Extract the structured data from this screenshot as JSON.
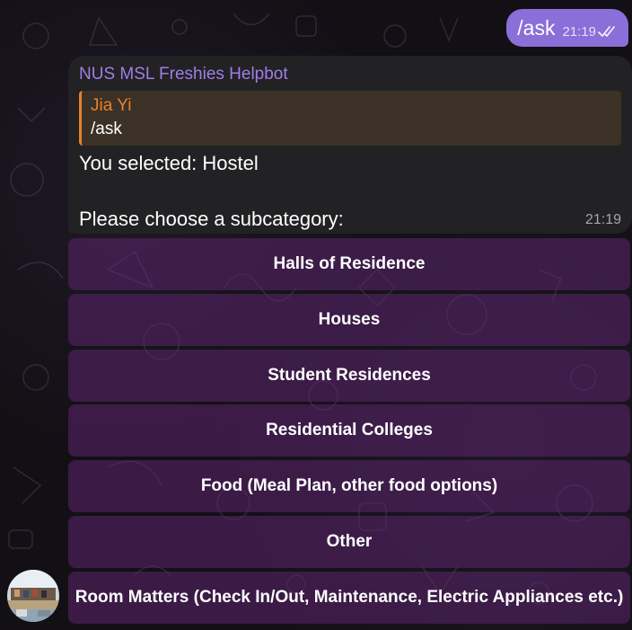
{
  "outgoing": {
    "text": "/ask",
    "time": "21:19",
    "status_icon": "double-check-icon"
  },
  "incoming": {
    "sender": "NUS MSL Freshies Helpbot",
    "reply_to": {
      "name": "Jia Yi",
      "text": "/ask"
    },
    "line1": "You selected: Hostel",
    "line2": "Please choose a subcategory:",
    "time": "21:19"
  },
  "keyboard": {
    "buttons": [
      "Halls of Residence",
      "Houses",
      "Student Residences",
      "Residential Colleges",
      "Food (Meal Plan, other food options)",
      "Other",
      "Room Matters (Check In/Out, Maintenance, Electric Appliances etc.)"
    ]
  },
  "colors": {
    "accent_purple": "#8a6fd8",
    "sender_name": "#a07ee6",
    "reply_accent": "#e8822b",
    "button_bg": "#5c246e"
  }
}
